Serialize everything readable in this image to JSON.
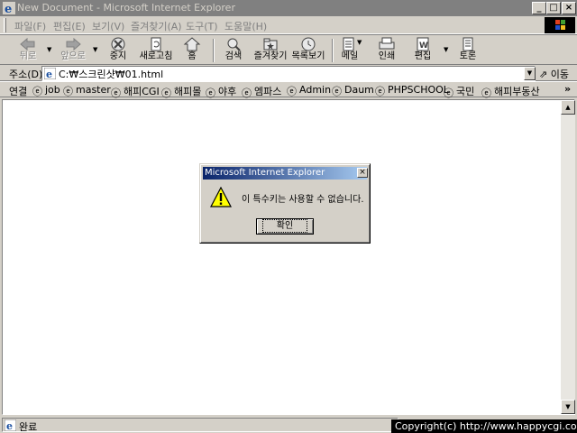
{
  "window": {
    "title": "New Document - Microsoft Internet Explorer",
    "controls": {
      "minimize": "_",
      "maximize": "□",
      "close": "×"
    }
  },
  "menu": [
    "파일(F)",
    "편집(E)",
    "보기(V)",
    "즐겨찾기(A)",
    "도구(T)",
    "도움말(H)"
  ],
  "toolbar": {
    "back": "뒤로",
    "forward": "앞으로",
    "stop": "중지",
    "refresh": "새로고침",
    "home": "홈",
    "search": "검색",
    "favorites": "즐겨찾기",
    "history": "목록보기",
    "mail": "메일",
    "print": "인쇄",
    "edit": "편집",
    "discuss": "토론"
  },
  "address": {
    "label": "주소(D)",
    "value": "C:₩스크린샷₩01.html",
    "go": "이동"
  },
  "links": {
    "label": "연결",
    "items": [
      "job",
      "master",
      "해피CGI",
      "해피몰",
      "야후",
      "엠파스",
      "Admin",
      "Daum",
      "PHPSCHOOL",
      "국민",
      "해피부동산"
    ],
    "more": "»"
  },
  "status": {
    "text": "완료"
  },
  "copyright": "Copyright(c) http://www.happycgi.com",
  "dialog": {
    "title": "Microsoft Internet Explorer",
    "message": "이 특수키는 사용할 수 없습니다.",
    "ok": "확인",
    "close": "×"
  },
  "colors": {
    "face": "#d4d0c8",
    "inactive_title": "#808080",
    "active_title_start": "#0a246a",
    "active_title_end": "#a6caf0"
  }
}
